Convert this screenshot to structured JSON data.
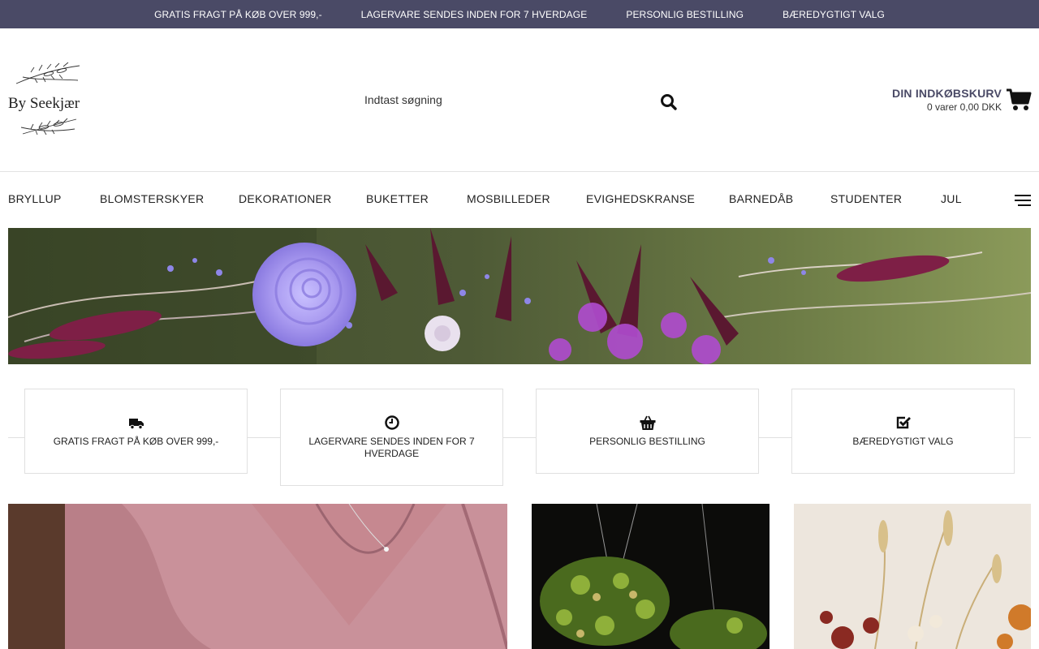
{
  "topbar": {
    "items": [
      "GRATIS FRAGT PÅ KØB OVER 999,-",
      "LAGERVARE SENDES INDEN FOR 7 HVERDAGE",
      "PERSONLIG BESTILLING",
      "BÆREDYGTIGT VALG"
    ]
  },
  "header": {
    "logo_text": "By Seekjær",
    "search_placeholder": "Indtast søgning",
    "search_icon": "search-icon",
    "cart_title": "DIN INDKØBSKURV",
    "cart_summary": "0 varer 0,00 DKK",
    "cart_icon": "shopping-cart-icon"
  },
  "nav": {
    "items": [
      "BRYLLUP",
      "BLOMSTERSKYER",
      "DEKORATIONER",
      "BUKETTER",
      "MOSBILLEDER",
      "EVIGHEDSKRANSE",
      "BARNEDÅB",
      "STUDENTER",
      "JUL"
    ],
    "menu_icon": "hamburger-menu-icon"
  },
  "usps": [
    {
      "icon": "truck-icon",
      "label": "GRATIS FRAGT PÅ KØB OVER 999,-"
    },
    {
      "icon": "clock-icon",
      "label": "LAGERVARE SENDES INDEN FOR 7 HVERDAGE"
    },
    {
      "icon": "basket-icon",
      "label": "PERSONLIG BESTILLING"
    },
    {
      "icon": "check-square-icon",
      "label": "BÆREDYGTIGT VALG"
    }
  ],
  "colors": {
    "topbar_bg": "#4a4a66",
    "cart_title": "#4a4a66",
    "hero_rose": "#a99af0",
    "hero_accent": "#7a1f4a"
  }
}
